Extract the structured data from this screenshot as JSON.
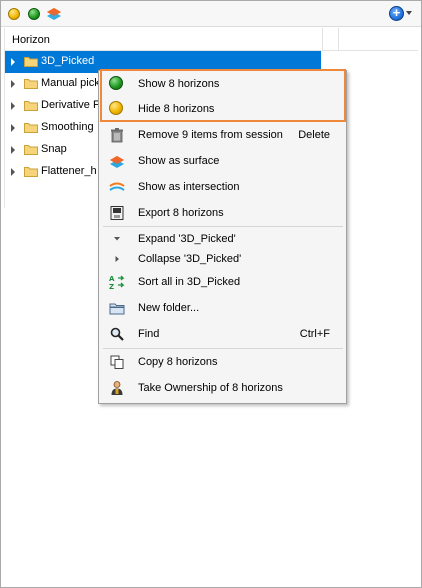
{
  "toolbar": {
    "icons": [
      "yellow-ball-icon",
      "green-ball-icon",
      "horizon-stack-icon",
      "add-plus-icon"
    ]
  },
  "tree": {
    "column_header": "Horizon",
    "items": [
      {
        "label": "3D_Picked",
        "selected": true
      },
      {
        "label": "Manual pick",
        "selected": false
      },
      {
        "label": "Derivative F",
        "selected": false
      },
      {
        "label": "Smoothing",
        "selected": false
      },
      {
        "label": "Snap",
        "selected": false
      },
      {
        "label": "Flattener_h",
        "selected": false
      }
    ]
  },
  "context_menu": {
    "items": [
      {
        "label": "Show 8 horizons",
        "icon": "green-ball-icon",
        "shortcut": ""
      },
      {
        "label": "Hide 8 horizons",
        "icon": "yellow-ball-icon",
        "shortcut": ""
      },
      {
        "label": "Remove 9 items from session",
        "icon": "trash-icon",
        "shortcut": "Delete"
      },
      {
        "label": "Show as surface",
        "icon": "surface-icon",
        "shortcut": ""
      },
      {
        "label": "Show as intersection",
        "icon": "intersection-icon",
        "shortcut": ""
      },
      {
        "label": "Export 8 horizons",
        "icon": "export-icon",
        "shortcut": ""
      },
      {
        "label": "Expand '3D_Picked'",
        "icon": "expand-arrow-icon",
        "shortcut": ""
      },
      {
        "label": "Collapse '3D_Picked'",
        "icon": "collapse-arrow-icon",
        "shortcut": ""
      },
      {
        "label": "Sort all in 3D_Picked",
        "icon": "sort-icon",
        "shortcut": ""
      },
      {
        "label": "New folder...",
        "icon": "new-folder-icon",
        "shortcut": ""
      },
      {
        "label": "Find",
        "icon": "magnifier-icon",
        "shortcut": "Ctrl+F"
      },
      {
        "label": "Copy 8 horizons",
        "icon": "copy-icon",
        "shortcut": ""
      },
      {
        "label": "Take Ownership of 8 horizons",
        "icon": "user-icon",
        "shortcut": ""
      }
    ]
  },
  "colors": {
    "selection": "#0078d7",
    "highlight_border": "#f0883c",
    "menu_background": "#f5f5f5"
  }
}
